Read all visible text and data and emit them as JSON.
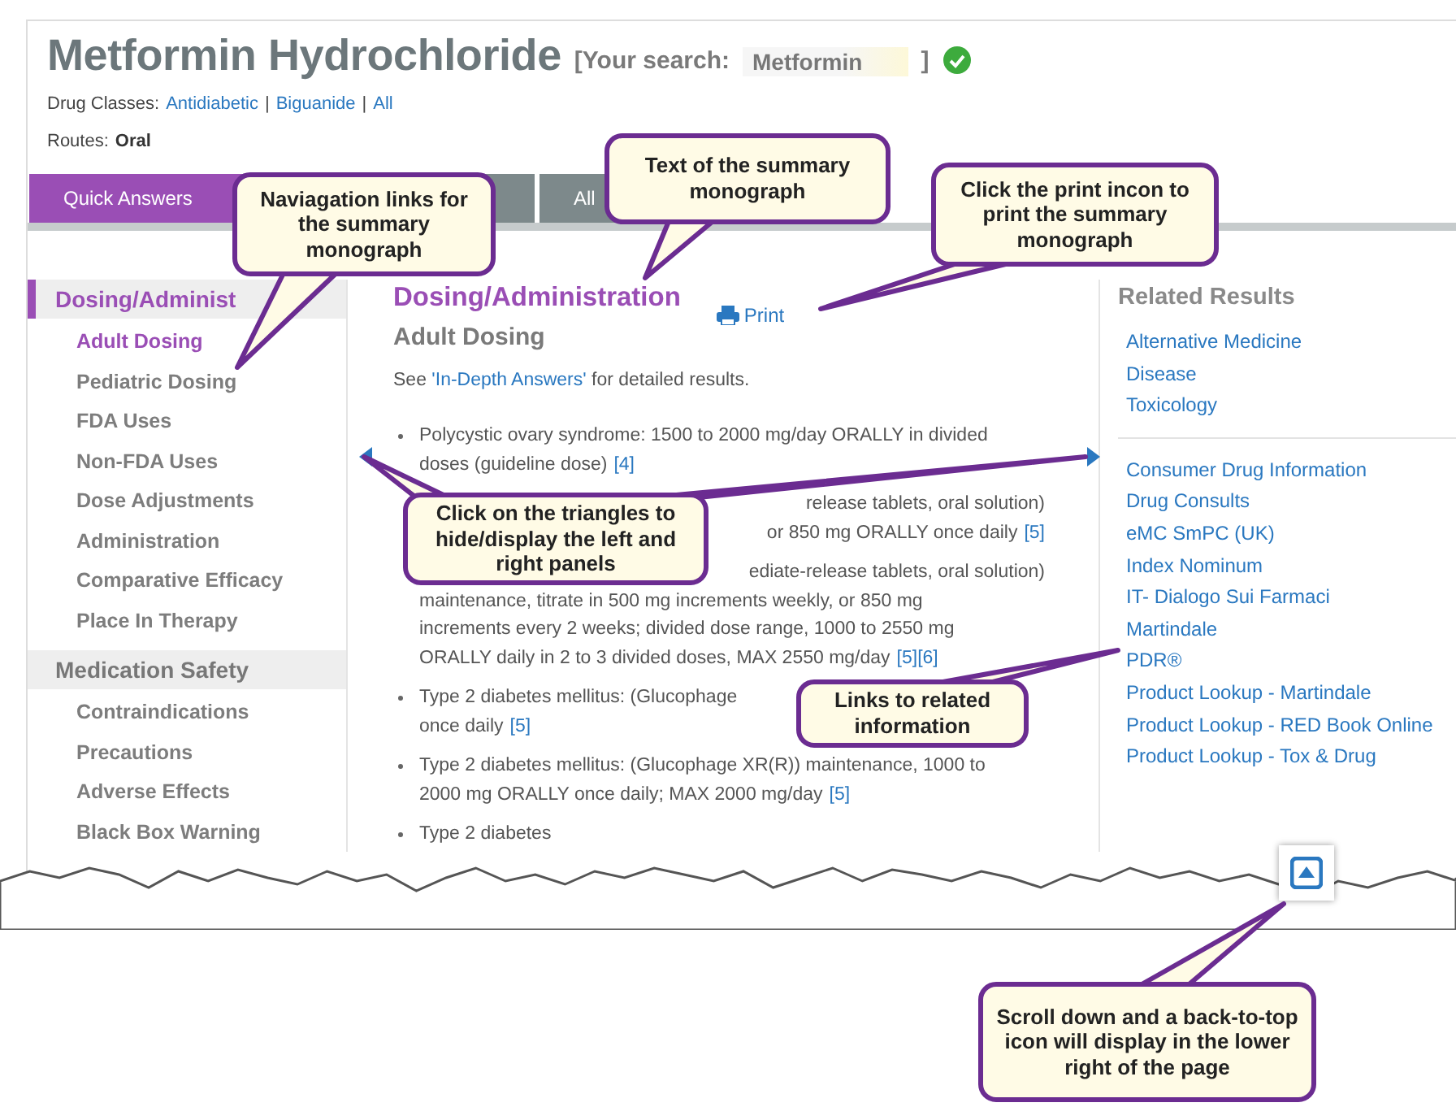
{
  "header": {
    "title": "Metformin Hydrochloride",
    "search_label": "[Your search:",
    "search_value": "Metformin",
    "search_close": "]",
    "verified": true
  },
  "drug_classes": {
    "label": "Drug Classes:",
    "links": [
      {
        "label": "Antidiabetic",
        "separator": "|"
      },
      {
        "label": "Biguanide",
        "separator": "|"
      },
      {
        "label": "All"
      }
    ]
  },
  "routes": {
    "label": "Routes:",
    "value": "Oral"
  },
  "tabs": [
    {
      "label": "Quick Answers",
      "selected": true
    },
    {
      "selected": false
    },
    {
      "label": "All",
      "selected": false
    }
  ],
  "sidebar": {
    "sections": [
      {
        "title": "Dosing/Administ",
        "selected": true,
        "items": [
          {
            "label": "Adult Dosing",
            "selected": true
          },
          {
            "label": "Pediatric Dosing",
            "selected": false
          },
          {
            "label": "FDA Uses",
            "selected": false
          },
          {
            "label": "Non-FDA Uses",
            "selected": false
          },
          {
            "label": "Dose Adjustments",
            "selected": false
          },
          {
            "label": "Administration",
            "selected": false
          },
          {
            "label": "Comparative Efficacy",
            "selected": false
          },
          {
            "label": "Place In Therapy",
            "selected": false
          }
        ]
      },
      {
        "title": "Medication Safety",
        "selected": false,
        "items": [
          {
            "label": "Contraindications",
            "selected": false
          },
          {
            "label": "Precautions",
            "selected": false
          },
          {
            "label": "Adverse Effects",
            "selected": false
          },
          {
            "label": "Black Box Warning",
            "selected": false
          }
        ]
      }
    ]
  },
  "content": {
    "heading": "Dosing/Administration",
    "print_label": "Print",
    "subheading": "Adult Dosing",
    "intro": {
      "before": "See",
      "link": "'In-Depth Answers'",
      "after": "for detailed results."
    },
    "bullets": [
      {
        "marker": true,
        "lines": [
          {
            "text": "Polycystic ovary syndrome: 1500 to 2000 mg/day ORALLY in divided",
            "cut_start": false
          },
          {
            "text": "doses (guideline dose)",
            "cite": "[4]",
            "cut_start": false
          }
        ]
      },
      {
        "marker": false,
        "lines": [
          {
            "text": "release tablets, oral solution)",
            "cut_start": true
          },
          {
            "text": "or 850 mg ORALLY once daily",
            "cite": "[5]",
            "cut_start": true
          }
        ]
      },
      {
        "marker": false,
        "lines": [
          {
            "text": "ediate-release tablets, oral solution)",
            "cut_start": true
          },
          {
            "text": "maintenance, titrate in 500 mg increments weekly, or 850 mg",
            "cut_start": false
          },
          {
            "text": "increments every 2 weeks; divided dose range, 1000 to 2550 mg",
            "cut_start": false
          },
          {
            "text": "ORALLY daily in 2 to 3 divided doses, MAX 2550 mg/day",
            "cite": "[5][6]",
            "cut_start": false
          }
        ]
      },
      {
        "marker": true,
        "lines": [
          {
            "text": "Type 2 diabetes mellitus: (Glucophage",
            "cut_start": false
          },
          {
            "text": "once daily",
            "cite": "[5]",
            "cut_start": false
          }
        ]
      },
      {
        "marker": true,
        "lines": [
          {
            "text": "Type 2 diabetes mellitus: (Glucophage XR(R)) maintenance, 1000 to",
            "cut_start": false
          },
          {
            "text": "2000 mg ORALLY once daily; MAX 2000 mg/day",
            "cite": "[5]",
            "cut_start": false
          }
        ]
      },
      {
        "marker": true,
        "lines": [
          {
            "text": "Type 2 diabetes",
            "cut_start": false
          }
        ]
      }
    ]
  },
  "related": {
    "title": "Related Results",
    "groups": [
      [
        "Alternative Medicine",
        "Disease",
        "Toxicology"
      ],
      [
        "Consumer Drug Information",
        "Drug Consults",
        "eMC SmPC (UK)",
        "Index Nominum",
        "IT- Dialogo Sui Farmaci",
        "Martindale",
        "PDR®",
        "Product Lookup - Martindale",
        "Product Lookup - RED Book Online",
        "Product Lookup - Tox & Drug"
      ]
    ]
  },
  "callouts": [
    {
      "text": "Naviagation links for the summary monograph"
    },
    {
      "text": "Text of the summary monograph"
    },
    {
      "text": "Click the print incon to print the summary monograph"
    },
    {
      "text": "Click on the triangles to hide/display the left and right panels"
    },
    {
      "text": "Links to related information"
    },
    {
      "text": "Scroll down and a back-to-top icon will display in the lower right of the page"
    }
  ]
}
